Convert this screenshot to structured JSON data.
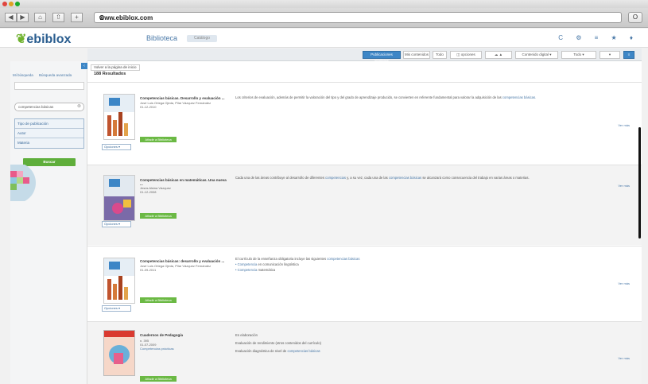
{
  "browser": {
    "url": "www.ebiblox.com",
    "back": "◀",
    "forward": "▶",
    "home": "⌂",
    "share": "⇧",
    "newtab": "+",
    "reload": "C",
    "menu": "O"
  },
  "site": {
    "logo": "ebiblox",
    "section": "Biblioteca",
    "section_pill": "Catálogo",
    "header_icons": "C ⚙ ≡ ★ ♦"
  },
  "toolbar": {
    "buttons": [
      "Publicaciones similares",
      "Mis contenidos",
      "Todo",
      "◫ opciones",
      "☁ ▲",
      "Contenido digital ▾",
      "Todo ▾",
      "▾",
      "≡"
    ]
  },
  "sidebar": {
    "links": [
      "Mi búsqueda",
      "Búsqueda avanzada"
    ],
    "search_value": "competencias básicas",
    "search_clear": "⊗",
    "filters": [
      "Tipo de publicación",
      "Autor",
      "Materia"
    ],
    "buscar": "Buscar",
    "collapse": "‹"
  },
  "main": {
    "back": "Volver a la página de inicio",
    "count": "188 Resultados"
  },
  "results": [
    {
      "title": "Competencias básicas. Desarrollo y evaluación ...",
      "authors": "José Luis Ortega Ojeda, Pilar Vázquez Fernández",
      "date": "01-12-2010",
      "btn": "Añadir a Biblioteca",
      "opciones": "Opciones ▾",
      "desc": "Los criterios de evaluación, además de permitir la valoración del tipo y del grado de aprendizaje producido, se convierten en referente fundamental para valorar la adquisición de las",
      "desc_link": "competencias básicas.",
      "vermas": "Ver más"
    },
    {
      "title": "Competencias básicas en matemáticas. Una nueva ...",
      "authors": "Jesús Alsina Vázquez",
      "date": "01-12-2008",
      "btn": "Añadir a Biblioteca",
      "opciones": "Opciones ▾",
      "desc": "Cada una de las áreas contribuye al desarrollo de diferentes",
      "desc_link": "competencias",
      "desc2": "y, a su vez, cada una de las",
      "desc_link2": "competencias básicas",
      "desc3": "se alcanzará como consecuencia del trabajo en varias áreas o materias.",
      "vermas": "Ver más"
    },
    {
      "title": "Competencias básicas: desarrollo y evaluación ...",
      "authors": "José Luis Ortega Ojeda, Pilar Vázquez Fernández",
      "date": "01-09-2011",
      "btn": "Añadir a Biblioteca",
      "opciones": "Opciones ▾",
      "line1": "El currículo de la enseñanza obligatoria incluye las siguientes",
      "line1_link": "competencias básicas",
      "line2_link": "• Competencia",
      "line2": "en comunicación lingüística",
      "line3_link": "• Competencia",
      "line3": "matemática",
      "vermas": "Ver más"
    },
    {
      "title": "Cuadernos de Pedagogía",
      "number": "n. 395",
      "date": "01-07-2009",
      "link": "Competencias prácticas",
      "btn": "Añadir a Biblioteca",
      "line1": "En elaboración",
      "line2": "Evaluación de rendimiento (otros contenidos del currículo)",
      "line3": "Evaluación diagnóstica de nivel de",
      "line3_link": "competencias básicas",
      "vermas": "Ver más"
    }
  ]
}
